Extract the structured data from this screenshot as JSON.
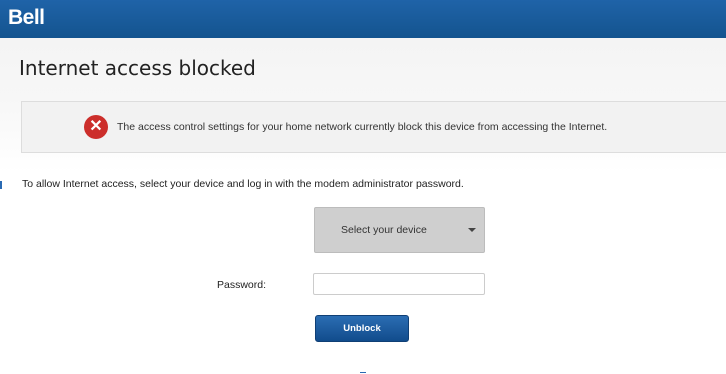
{
  "header": {
    "brand": "Bell"
  },
  "page": {
    "title": "Internet access blocked"
  },
  "alert": {
    "icon": "error-x-icon",
    "message": "The access control settings for your home network currently block this device from accessing the Internet."
  },
  "instruction": "To allow Internet access, select your device and log in with the modem administrator password.",
  "device_select": {
    "selected": "Select your device",
    "icon": "chevron-down-icon"
  },
  "password": {
    "label": "Password:",
    "value": ""
  },
  "unblock_button": {
    "label": "Unblock"
  },
  "colors": {
    "header_blue": "#1f63a8",
    "error_red": "#cc2e2b",
    "button_blue": "#1f5fa3"
  }
}
